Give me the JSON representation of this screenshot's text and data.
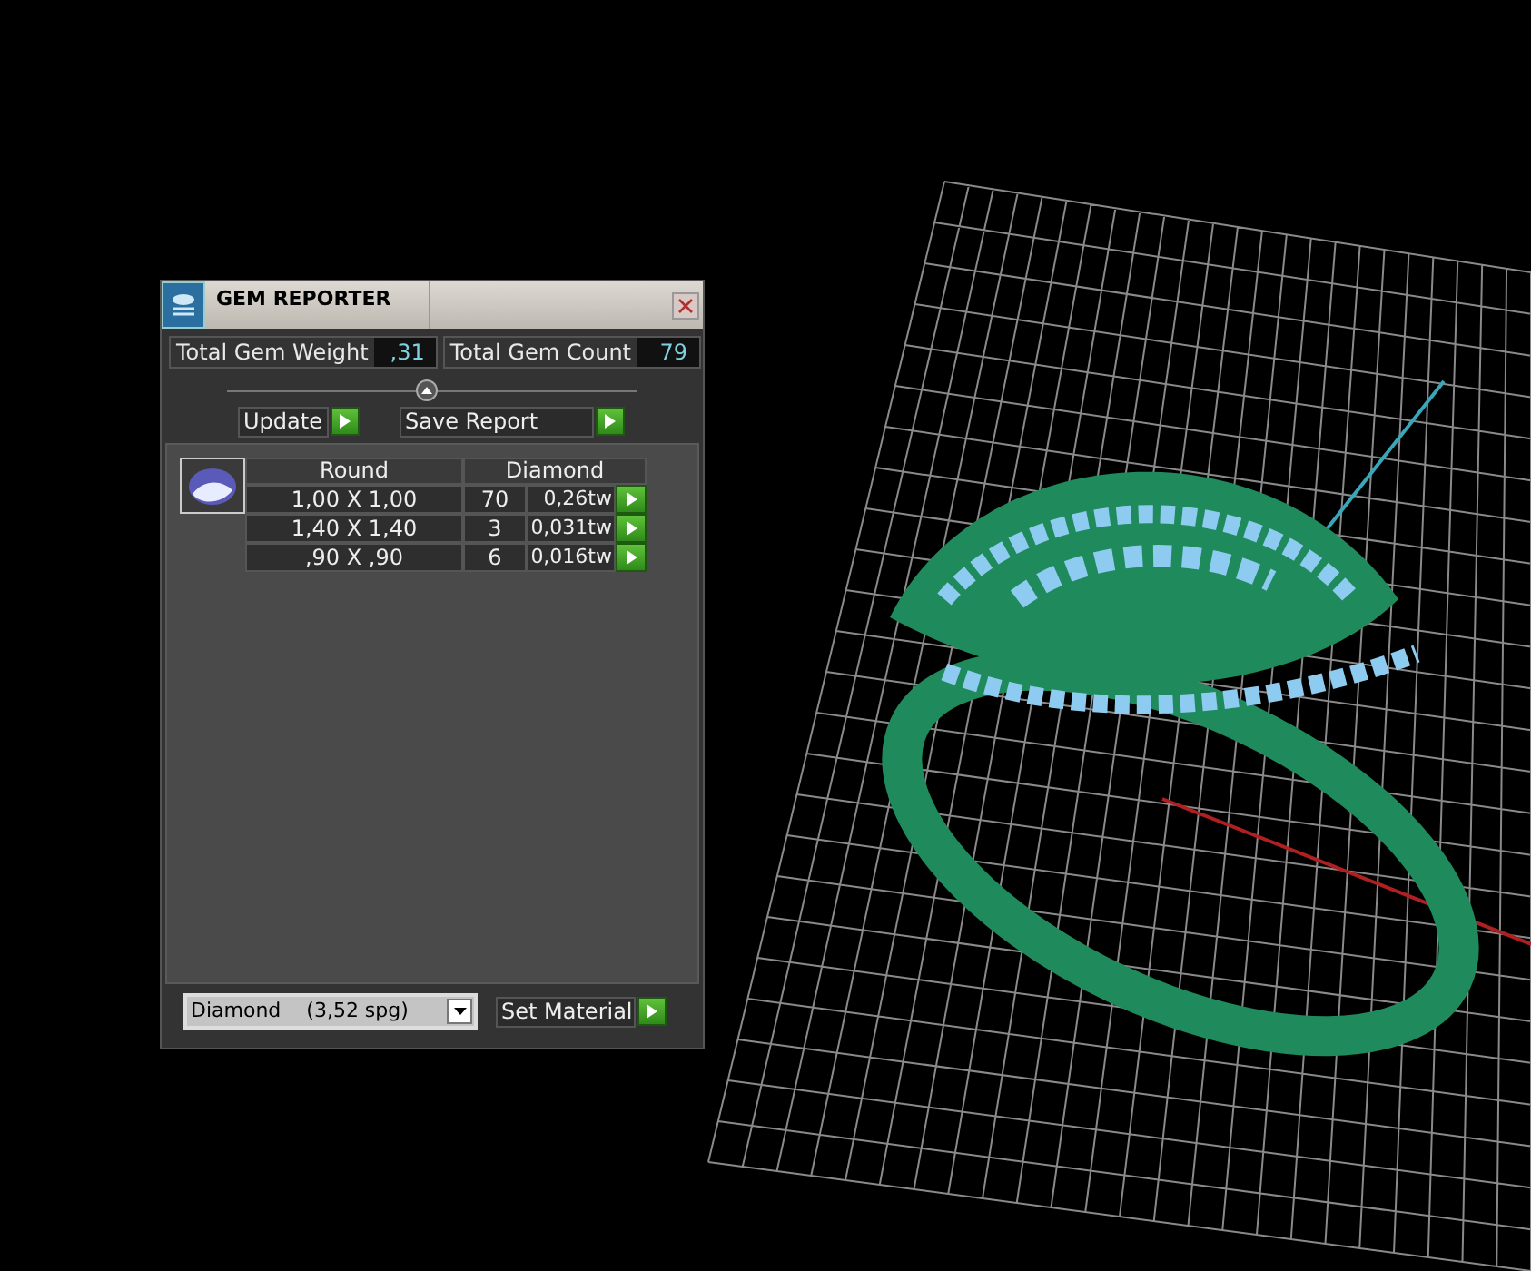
{
  "window": {
    "title": "GEM REPORTER"
  },
  "totals": [
    {
      "label": "Total Gem Weight",
      "value": ",31"
    },
    {
      "label": "Total Gem Count",
      "value": "79"
    }
  ],
  "actions": [
    {
      "label": "Update"
    },
    {
      "label": "Save Report"
    }
  ],
  "table": {
    "columns": [
      "Round",
      "Diamond"
    ],
    "rows": [
      {
        "size": "1,00 X 1,00",
        "count": "70",
        "weight": "0,26tw"
      },
      {
        "size": "1,40 X 1,40",
        "count": "3",
        "weight": "0,031tw"
      },
      {
        "size": ",90 X ,90",
        "count": "6",
        "weight": "0,016tw"
      }
    ]
  },
  "material": {
    "value": "Diamond    (3,52 spg)"
  },
  "set_material": {
    "label": "Set Material"
  }
}
